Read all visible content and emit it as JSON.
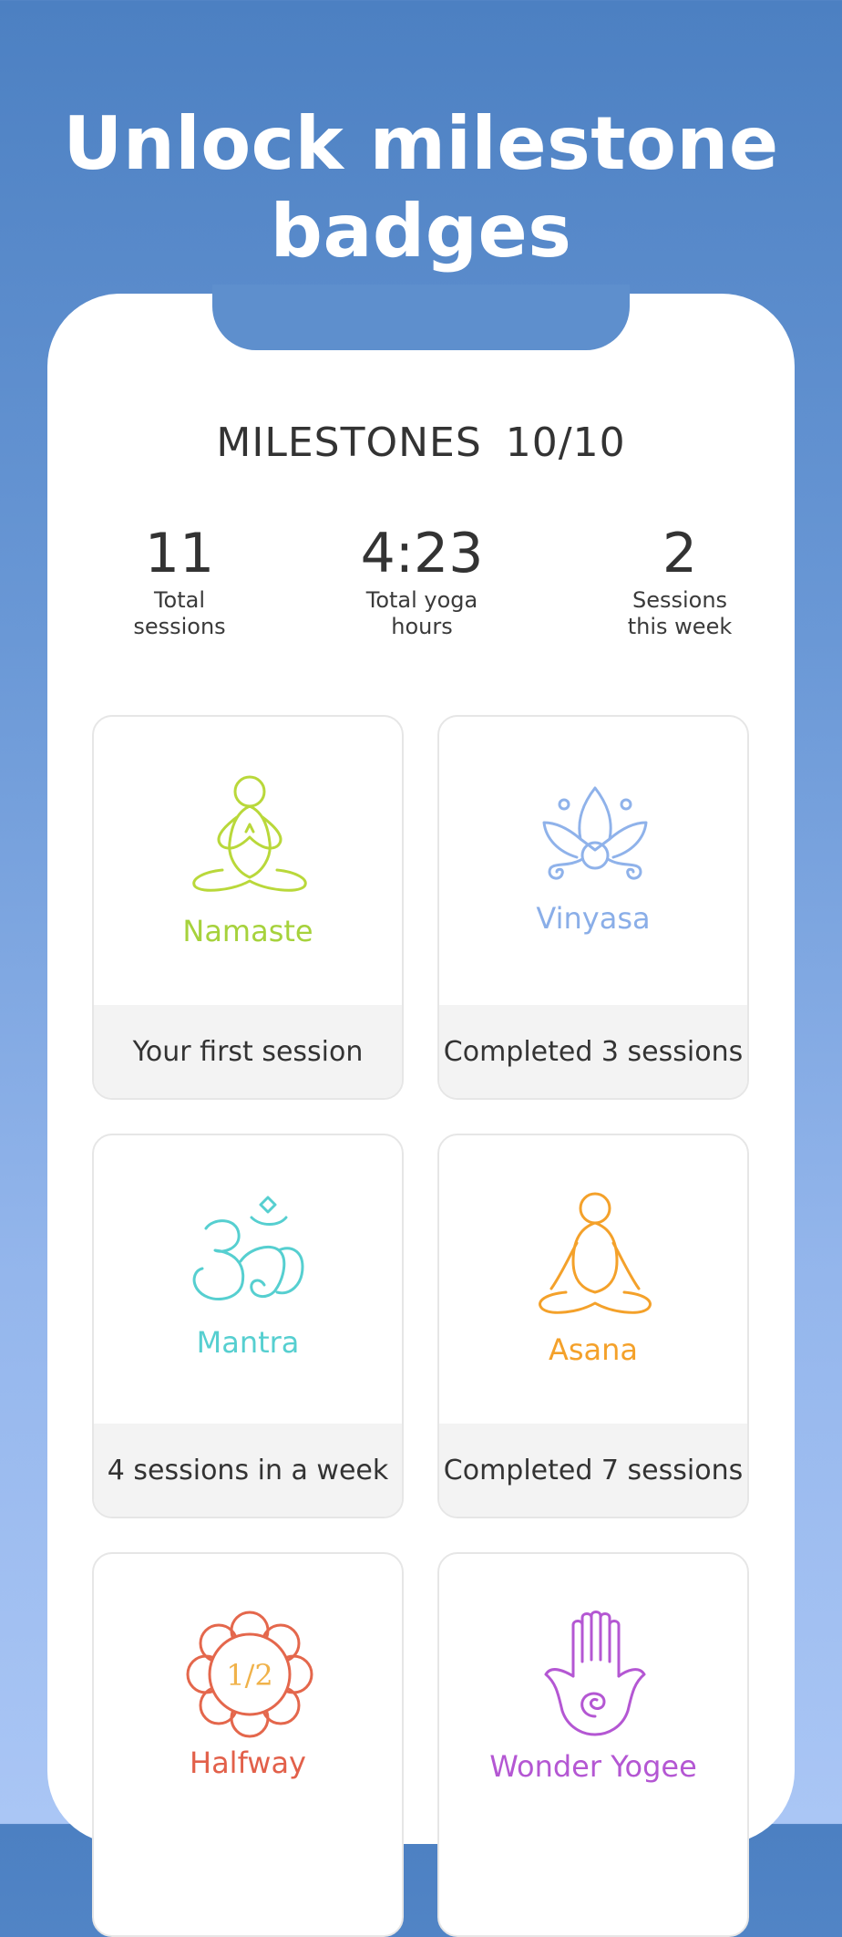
{
  "headline": "Unlock milestone badges",
  "milestones": {
    "label": "MILESTONES",
    "count": "10/10"
  },
  "stats": [
    {
      "value": "11",
      "label": "Total\nsessions"
    },
    {
      "value": "4:23",
      "label": "Total yoga\nhours"
    },
    {
      "value": "2",
      "label": "Sessions\nthis week"
    }
  ],
  "badges": [
    {
      "name": "Namaste",
      "caption": "Your first session",
      "icon": "meditation-figure-icon",
      "color": "#a6d23c"
    },
    {
      "name": "Vinyasa",
      "caption": "Completed 3 sessions",
      "icon": "lotus-icon",
      "color": "#8aaee8"
    },
    {
      "name": "Mantra",
      "caption": "4 sessions in a week",
      "icon": "om-icon",
      "color": "#56cfd0"
    },
    {
      "name": "Asana",
      "caption": "Completed 7 sessions",
      "icon": "lotus-pose-figure-icon",
      "color": "#f4a12a"
    },
    {
      "name": "Halfway",
      "caption": "",
      "icon": "half-flower-icon",
      "icon_text": "1/2",
      "color": "#e2604a"
    },
    {
      "name": "Wonder Yogee",
      "caption": "",
      "icon": "hamsa-hand-icon",
      "color": "#b457d3"
    }
  ],
  "colors": {
    "background_top": "#4c80c2",
    "background_bottom": "#aac6f5",
    "card_border": "#e6e6e6",
    "caption_bg": "#f3f3f3"
  }
}
